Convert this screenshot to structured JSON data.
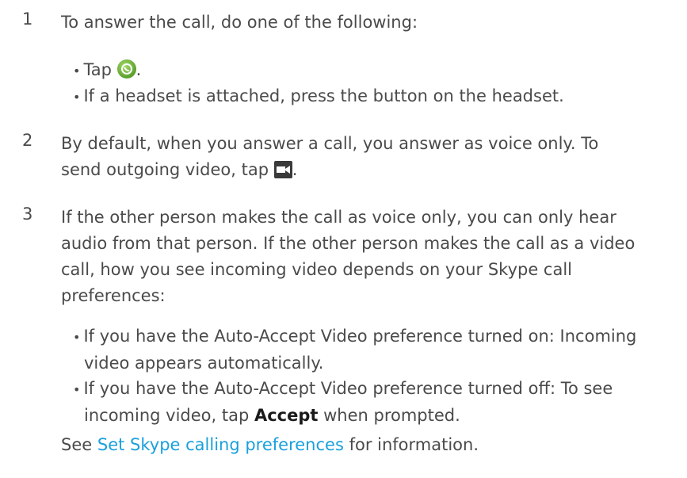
{
  "steps": [
    {
      "number": "1",
      "text": "To answer the call, do one of the following:",
      "bullets": [
        {
          "before": "Tap ",
          "icon": "answer-call-icon",
          "after": "."
        },
        {
          "text": "If a headset is attached, press the button on the headset."
        }
      ]
    },
    {
      "number": "2",
      "line1": "By default, when you answer a call, you answer as voice only. To",
      "line2_before": "send outgoing video, tap ",
      "icon": "video-camera-icon",
      "line2_after": "."
    },
    {
      "number": "3",
      "lines": [
        "If the other person makes the call as voice only, you can only hear",
        "audio from that person. If the other person makes the call as a video",
        "call, how you see incoming video depends on your Skype call",
        "preferences:"
      ],
      "bullets": [
        {
          "lines": [
            "If you have the Auto-Accept Video preference turned on: Incoming",
            "video appears automatically."
          ]
        },
        {
          "line1": "If you have the Auto-Accept Video preference turned off: To see",
          "line2_before": "incoming video, tap ",
          "bold": "Accept",
          "line2_after": " when prompted."
        }
      ],
      "see_before": "See ",
      "see_link": "Set Skype calling preferences",
      "see_after": " for information."
    }
  ],
  "colors": {
    "text": "#4a4a4a",
    "link": "#1aa0db",
    "answer_icon": "#5aa02c",
    "video_icon": "#3a3a3a"
  }
}
